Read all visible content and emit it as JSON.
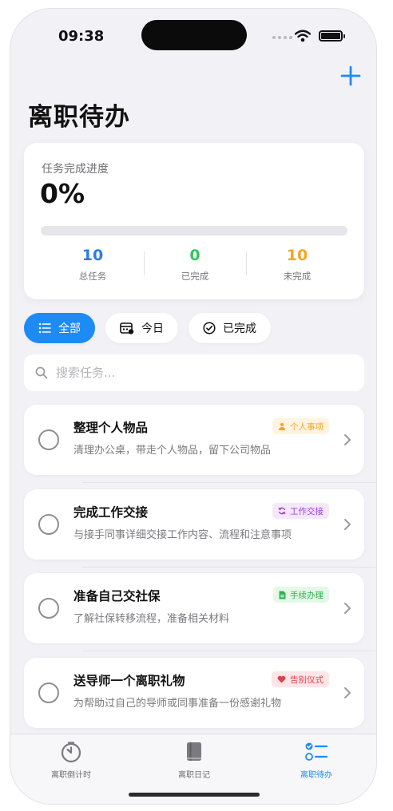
{
  "status_bar": {
    "time": "09:38"
  },
  "header": {
    "title": "离职待办"
  },
  "progress": {
    "label": "任务完成进度",
    "percent_text": "0%",
    "fraction": 0,
    "stats": [
      {
        "value": "10",
        "label": "总任务",
        "color": "#2a7de0"
      },
      {
        "value": "0",
        "label": "已完成",
        "color": "#34c759"
      },
      {
        "value": "10",
        "label": "未完成",
        "color": "#f5a623"
      }
    ]
  },
  "filters": [
    {
      "label": "全部",
      "icon": "list-icon",
      "active": true
    },
    {
      "label": "今日",
      "icon": "calendar-icon",
      "active": false
    },
    {
      "label": "已完成",
      "icon": "checkmark-circle-icon",
      "active": false
    }
  ],
  "search": {
    "placeholder": "搜索任务...",
    "value": ""
  },
  "tasks": [
    {
      "title": "整理个人物品",
      "description": "清理办公桌，带走个人物品，留下公司物品",
      "tag": "个人事项",
      "tag_icon": "person-icon",
      "tag_color": "#f5a623",
      "tag_bg": "#fff4e0"
    },
    {
      "title": "完成工作交接",
      "description": "与接手同事详细交接工作内容、流程和注意事项",
      "tag": "工作交接",
      "tag_icon": "refresh-icon",
      "tag_color": "#a040d8",
      "tag_bg": "#f5e8fc"
    },
    {
      "title": "准备自己交社保",
      "description": "了解社保转移流程，准备相关材料",
      "tag": "手续办理",
      "tag_icon": "document-icon",
      "tag_color": "#2fb352",
      "tag_bg": "#e4f7e8"
    },
    {
      "title": "送导师一个离职礼物",
      "description": "为帮助过自己的导师或同事准备一份感谢礼物",
      "tag": "告别仪式",
      "tag_icon": "heart-icon",
      "tag_color": "#e0404a",
      "tag_bg": "#fde6e7"
    }
  ],
  "tabbar": [
    {
      "label": "离职倒计时",
      "icon": "timer-icon",
      "active": false
    },
    {
      "label": "离职日记",
      "icon": "book-icon",
      "active": false
    },
    {
      "label": "离职待办",
      "icon": "checklist-icon",
      "active": true
    }
  ],
  "colors": {
    "accent": "#1e8bf5",
    "background": "#f2f2f6"
  }
}
